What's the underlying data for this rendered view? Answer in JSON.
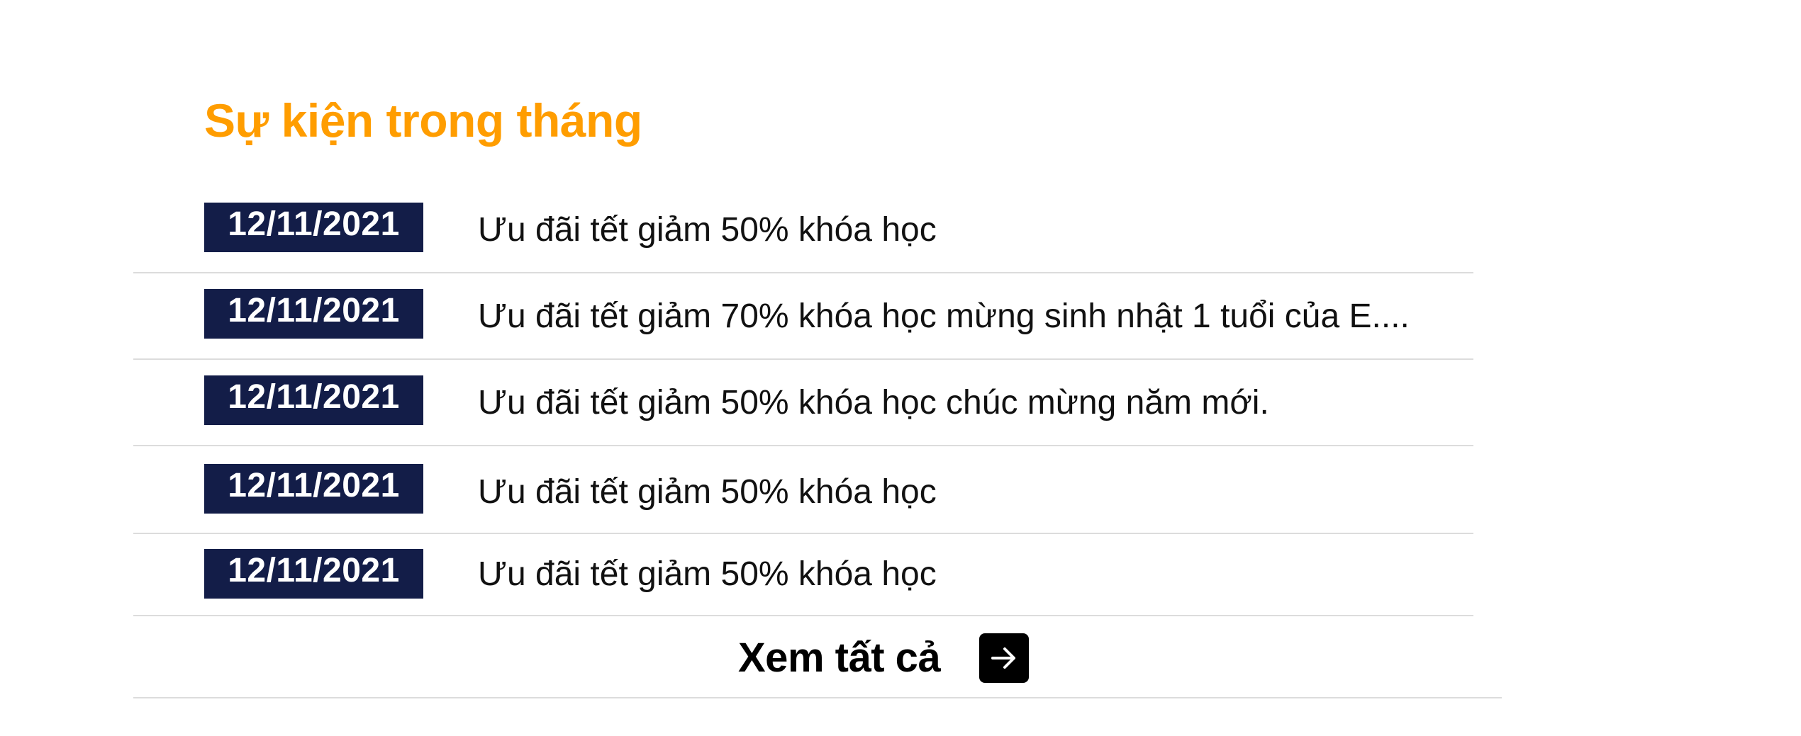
{
  "events_section": {
    "title": "Sự kiện trong tháng",
    "events": [
      {
        "date": "12/11/2021",
        "title": "Ưu đãi tết giảm 50% khóa học"
      },
      {
        "date": "12/11/2021",
        "title": "Ưu đãi tết giảm 70% khóa học mừng sinh nhật 1 tuổi của E...."
      },
      {
        "date": "12/11/2021",
        "title": "Ưu đãi tết giảm 50% khóa học chúc mừng năm mới."
      },
      {
        "date": "12/11/2021",
        "title": "Ưu đãi tết giảm 50% khóa học"
      },
      {
        "date": "12/11/2021",
        "title": "Ưu đãi tết giảm 50% khóa học"
      }
    ],
    "see_all": {
      "label": "Xem tất cả",
      "icon": "arrow-right-icon"
    }
  },
  "colors": {
    "title": "#ff9d00",
    "date_badge_bg": "#131d48",
    "date_badge_text": "#ffffff",
    "event_text": "#111111",
    "divider": "#dcdcdc",
    "see_all_text": "#000000",
    "arrow_box_bg": "#000000"
  }
}
